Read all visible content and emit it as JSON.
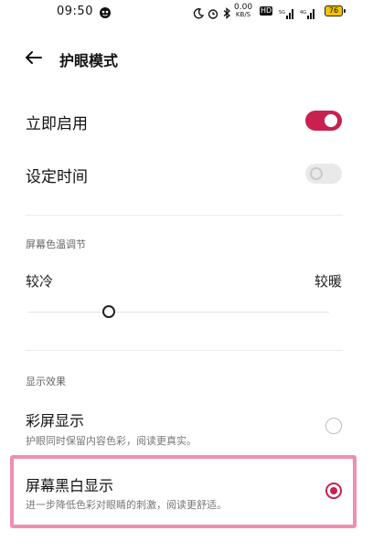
{
  "status_bar": {
    "time": "09:50",
    "speed_value": "0.00",
    "speed_unit": "KB/S",
    "hd_badge": "HD",
    "battery": "76"
  },
  "header": {
    "title": "护眼模式"
  },
  "settings": {
    "enable_now": {
      "label": "立即启用",
      "on": true
    },
    "schedule": {
      "label": "设定时间",
      "on": false
    }
  },
  "color_temperature": {
    "section_title": "屏幕色温调节",
    "left_label": "较冷",
    "right_label": "较暖",
    "value": 0.27
  },
  "display_effect": {
    "section_title": "显示效果",
    "options": [
      {
        "title": "彩屏显示",
        "desc": "护眼同时保留内容色彩，阅读更真实。",
        "selected": false
      },
      {
        "title": "屏幕黑白显示",
        "desc": "进一步降低色彩对眼睛的刺激，阅读更舒适。",
        "selected": true
      }
    ]
  },
  "colors": {
    "accent": "#c8214f",
    "highlight": "#ee8fae"
  }
}
